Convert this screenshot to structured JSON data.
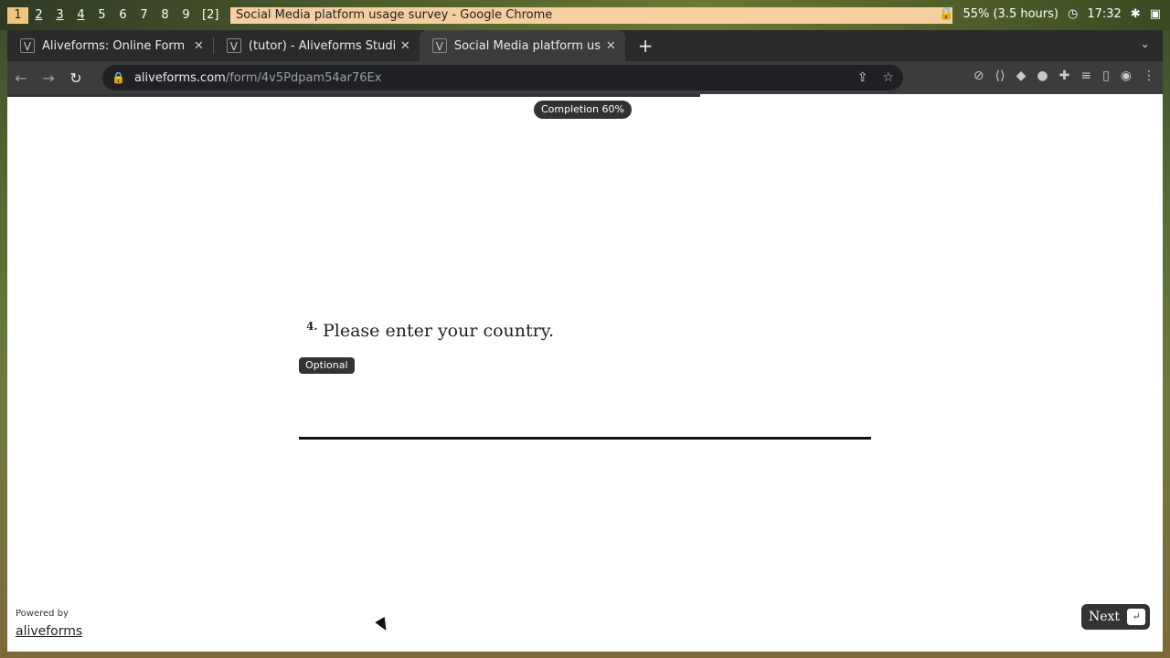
{
  "wm": {
    "workspaces": [
      "1",
      "2",
      "3",
      "4",
      "5",
      "6",
      "7",
      "8",
      "9"
    ],
    "window_count": "[2]",
    "title": "Social Media platform usage survey - Google Chrome",
    "battery": "55% (3.5 hours)",
    "clock": "17:32"
  },
  "browser": {
    "tabs": [
      {
        "label": "Aliveforms: Online Form Builder"
      },
      {
        "label": "(tutor) - Aliveforms Studio"
      },
      {
        "label": "Social Media platform usage survey"
      }
    ],
    "url_host": "aliveforms.com",
    "url_path": "/form/4v5Pdpam54ar76Ex"
  },
  "page": {
    "completion_label": "Completion 60%",
    "completion_percent": 60,
    "question_number": "4.",
    "question_text": "Please enter your country.",
    "optional_label": "Optional",
    "answer_value": "",
    "powered_by": "Powered by",
    "brand": "aliveforms",
    "next_label": "Next",
    "enter_key": "↵"
  },
  "colors": {
    "accent": "#333333",
    "title_bg": "#f5cfa0",
    "active_ws": "#f2c57c"
  }
}
